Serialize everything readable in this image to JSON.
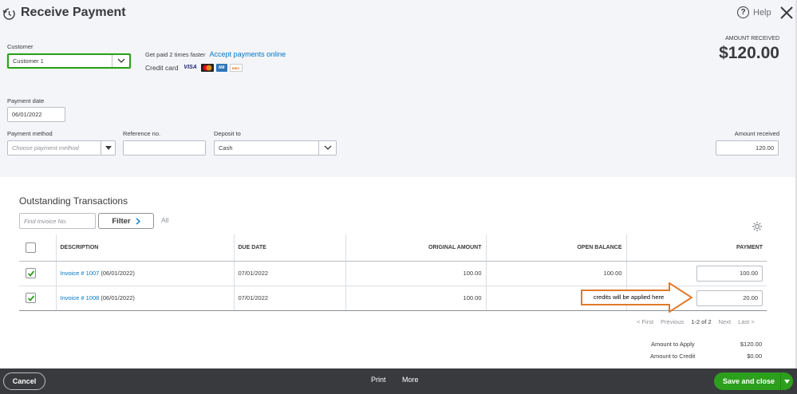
{
  "header": {
    "title": "Receive Payment",
    "help_label": "Help"
  },
  "customer": {
    "label": "Customer",
    "value": "Customer 1"
  },
  "promo": {
    "text": "Get paid 2 times faster",
    "link": "Accept payments online",
    "credit_card_label": "Credit card",
    "cards": [
      {
        "name": "VISA",
        "bg": "#ffffff",
        "fg": "#1a1f71"
      },
      {
        "name": "MC",
        "bg": "#eb001b",
        "fg": "#f79e1b"
      },
      {
        "name": "AMEX",
        "bg": "#2e77bc",
        "fg": "#ffffff"
      },
      {
        "name": "DISCOVER",
        "bg": "#ffffff",
        "fg": "#e65c00"
      }
    ]
  },
  "amount_received_header": {
    "label": "AMOUNT RECEIVED",
    "value": "$120.00"
  },
  "payment_date": {
    "label": "Payment date",
    "value": "06/01/2022"
  },
  "payment_method": {
    "label": "Payment method",
    "placeholder": "Choose payment method"
  },
  "reference": {
    "label": "Reference no.",
    "value": ""
  },
  "deposit_to": {
    "label": "Deposit to",
    "value": "Cash"
  },
  "amount_received": {
    "label": "Amount received",
    "value": "120.00"
  },
  "outstanding": {
    "title": "Outstanding Transactions",
    "find_placeholder": "Find Invoice No.",
    "filter_label": "Filter",
    "all_label": "All",
    "columns": [
      "DESCRIPTION",
      "DUE DATE",
      "ORIGINAL AMOUNT",
      "OPEN BALANCE",
      "PAYMENT"
    ],
    "rows": [
      {
        "invoice": "Invoice # 1007",
        "date": "(06/01/2022)",
        "due": "07/01/2022",
        "original": "100.00",
        "open": "100.00",
        "payment": "100.00",
        "checked": true
      },
      {
        "invoice": "Invoice # 1008",
        "date": "(06/01/2022)",
        "due": "07/01/2022",
        "original": "100.00",
        "open": "",
        "payment": "20.00",
        "checked": true
      }
    ],
    "annotation": "credits will be applied here"
  },
  "pager": {
    "first": "< First",
    "previous": "Previous",
    "range": "1-2 of 2",
    "next": "Next",
    "last": "Last >"
  },
  "summary": {
    "apply_label": "Amount to Apply",
    "apply_value": "$120.00",
    "credit_label": "Amount to Credit",
    "credit_value": "$0.00"
  },
  "footer": {
    "cancel": "Cancel",
    "print": "Print",
    "more": "More",
    "save": "Save and close"
  },
  "colors": {
    "accent_green": "#2ca01c",
    "link_blue": "#0077c5",
    "annotation_orange": "#e07a2b",
    "footer_bg": "#393a3d"
  }
}
